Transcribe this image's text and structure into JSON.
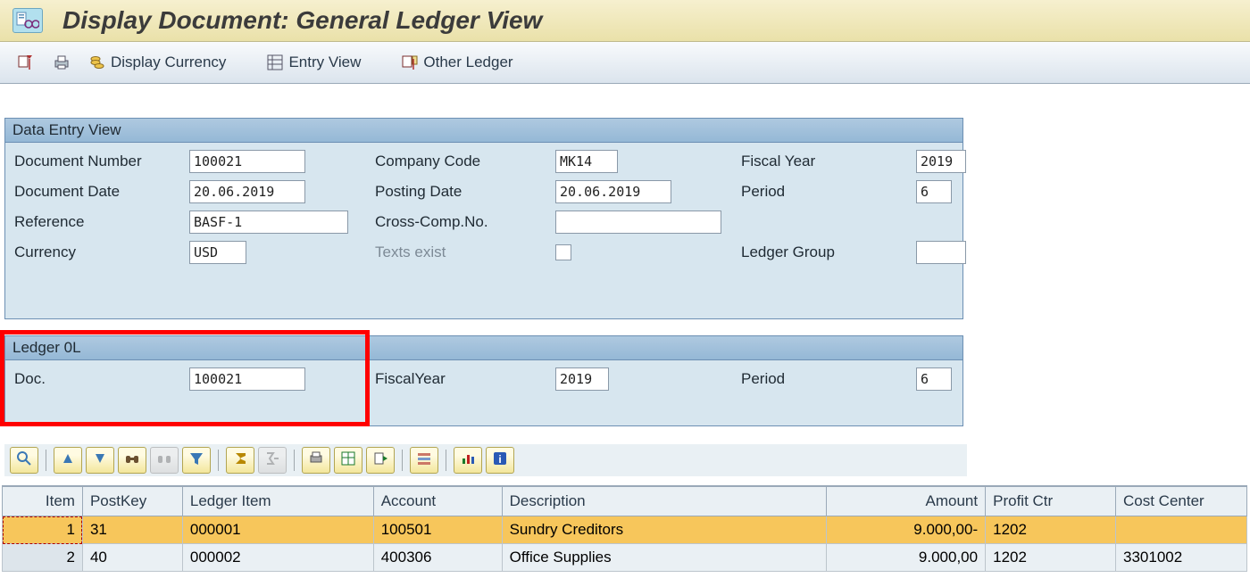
{
  "window": {
    "title": "Display Document: General Ledger View"
  },
  "toolbar": {
    "display_currency_label": "Display Currency",
    "entry_view_label": "Entry View",
    "other_ledger_label": "Other Ledger"
  },
  "data_entry_view": {
    "title": "Data Entry View",
    "document_number_label": "Document Number",
    "document_number": "100021",
    "company_code_label": "Company Code",
    "company_code": "MK14",
    "fiscal_year_label": "Fiscal Year",
    "fiscal_year": "2019",
    "document_date_label": "Document Date",
    "document_date": "20.06.2019",
    "posting_date_label": "Posting Date",
    "posting_date": "20.06.2019",
    "period_label": "Period",
    "period": "6",
    "reference_label": "Reference",
    "reference": "BASF-1",
    "cross_comp_no_label": "Cross-Comp.No.",
    "cross_comp_no": "",
    "currency_label": "Currency",
    "currency": "USD",
    "texts_exist_label": "Texts exist",
    "ledger_group_label": "Ledger Group",
    "ledger_group": ""
  },
  "ledger_view": {
    "title": "Ledger 0L",
    "doc_label": "Doc.",
    "doc": "100021",
    "fiscal_year_label": "FiscalYear",
    "fiscal_year": "2019",
    "period_label": "Period",
    "period": "6"
  },
  "grid": {
    "columns": {
      "item": "Item",
      "postkey": "PostKey",
      "ledger_item": "Ledger Item",
      "account": "Account",
      "description": "Description",
      "amount": "Amount",
      "profit_ctr": "Profit Ctr",
      "cost_center": "Cost Center"
    },
    "rows": [
      {
        "item": "1",
        "postkey": "31",
        "ledger_item": "000001",
        "account": "100501",
        "description": "Sundry Creditors",
        "amount": "9.000,00-",
        "profit_ctr": "1202",
        "cost_center": ""
      },
      {
        "item": "2",
        "postkey": "40",
        "ledger_item": "000002",
        "account": "400306",
        "description": "Office Supplies",
        "amount": "9.000,00",
        "profit_ctr": "1202",
        "cost_center": "3301002"
      }
    ]
  }
}
